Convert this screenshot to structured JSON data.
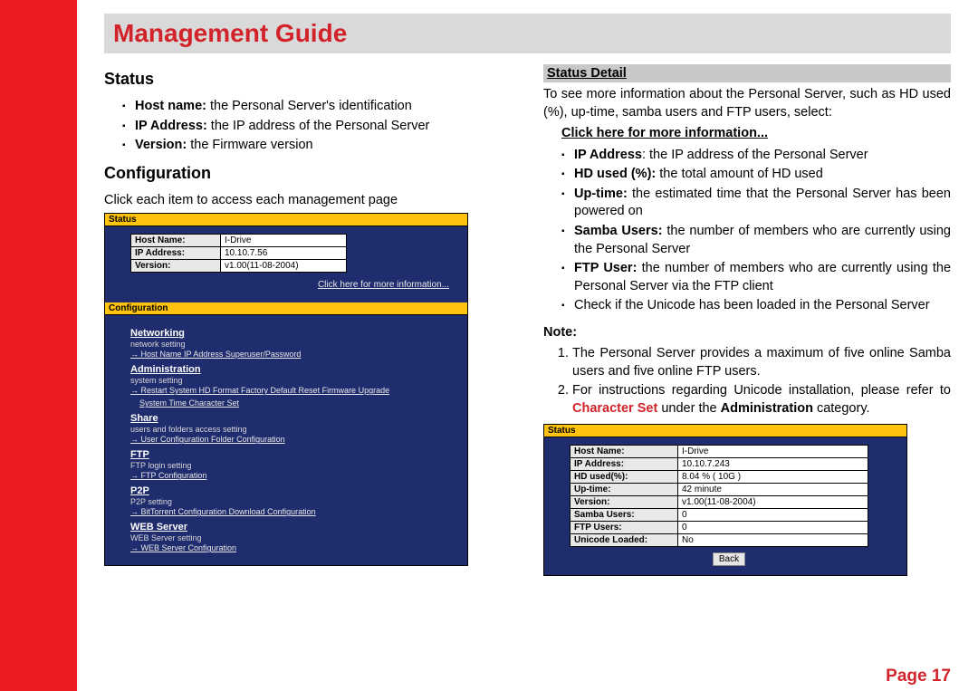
{
  "title": "Management Guide",
  "pageNum": "Page 17",
  "left": {
    "statusHdr": "Status",
    "statusItems": [
      {
        "b": "Host name:",
        "t": " the Personal Server's identification"
      },
      {
        "b": "IP Address:",
        "t": " the IP address of the Personal Server"
      },
      {
        "b": "Version:",
        "t": " the Firmware version"
      }
    ],
    "configHdr": "Configuration",
    "configIntro": "Click each item to access each management page"
  },
  "mini1": {
    "hdr1": "Status",
    "rows": [
      [
        "Host Name:",
        "I-Drive"
      ],
      [
        "IP Address:",
        "10.10.7.56"
      ],
      [
        "Version:",
        "v1.00(11-08-2004)"
      ]
    ],
    "moreLink": "Click here for more information...",
    "hdr2": "Configuration",
    "sections": [
      {
        "title": "Networking",
        "sub": "network setting",
        "links": "Host Name  IP Address  Superuser/Password"
      },
      {
        "title": "Administration",
        "sub": "system setting",
        "links": "Restart System  HD Format  Factory Default Reset  Firmware Upgrade",
        "links2": "System Time  Character Set"
      },
      {
        "title": "Share",
        "sub": "users and folders access setting",
        "links": "User Configuration  Folder Configuration"
      },
      {
        "title": "FTP",
        "sub": "FTP login setting",
        "links": "FTP Configuration"
      },
      {
        "title": "P2P",
        "sub": "P2P setting",
        "links": "BitTorrent Configuration  Download Configuration"
      },
      {
        "title": "WEB Server",
        "sub": "WEB Server setting",
        "links": "WEB Server Configuration"
      }
    ]
  },
  "right": {
    "detailHdr": "Status Detail",
    "detailIntro": "To see more information about the Personal Server, such as HD used (%), up-time, samba users and FTP users, select:",
    "clickHere": "Click here for more information...",
    "detailItems": [
      {
        "b": "IP Address",
        "t": ": the IP address of the Personal Server"
      },
      {
        "b": "HD used (%):",
        "t": " the total amount of HD used"
      },
      {
        "b": "Up-time:",
        "t": " the estimated time that the Personal Server has been powered on"
      },
      {
        "b": "Samba Users:",
        "t": " the number of members who are currently using the Personal Server"
      },
      {
        "b": "FTP User:",
        "t": " the number of members who are currently using the Personal Server via the FTP client"
      },
      {
        "b": "",
        "t": "Check if the Unicode has been loaded in the Personal Server"
      }
    ],
    "noteHdr": "Note:",
    "notes": [
      "The Personal Server provides a maximum of five online Samba users and five online FTP users.",
      {
        "parts": [
          "For instructions regarding Unicode installation, please refer to ",
          {
            "red": "Character Set"
          },
          " under the ",
          {
            "bold": "Administration"
          },
          " category."
        ]
      }
    ]
  },
  "mini2": {
    "hdr": "Status",
    "rows": [
      [
        "Host Name:",
        "I-Drive"
      ],
      [
        "IP Address:",
        "10.10.7.243"
      ],
      [
        "HD used(%):",
        "8.04 % ( 10G )"
      ],
      [
        "Up-time:",
        "42 minute"
      ],
      [
        "Version:",
        "v1.00(11-08-2004)"
      ],
      [
        "Samba Users:",
        "0"
      ],
      [
        "FTP Users:",
        "0"
      ],
      [
        "Unicode Loaded:",
        "No"
      ]
    ],
    "back": "Back"
  }
}
